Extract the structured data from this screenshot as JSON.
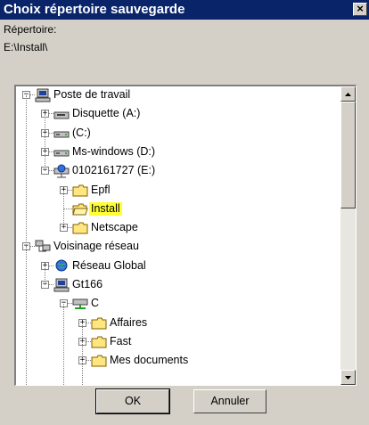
{
  "window": {
    "title": "Choix répertoire sauvegarde",
    "close_label": "×"
  },
  "directory": {
    "label": "Répertoire:",
    "path": "E:\\Install\\"
  },
  "tree": [
    {
      "label": "Poste de travail",
      "icon": "computer-icon",
      "expander": "−"
    },
    {
      "label": "Disquette (A:)",
      "icon": "floppy-drive-icon",
      "expander": "+"
    },
    {
      "label": "(C:)",
      "icon": "hard-drive-icon",
      "expander": "+"
    },
    {
      "label": "Ms-windows (D:)",
      "icon": "hard-drive-icon",
      "expander": "+"
    },
    {
      "label": "0102161727 (E:)",
      "icon": "network-drive-icon",
      "expander": "−"
    },
    {
      "label": "Epfl",
      "icon": "folder-icon",
      "expander": "+"
    },
    {
      "label": "Install",
      "icon": "folder-open-icon",
      "expander": "",
      "selected": true
    },
    {
      "label": "Netscape",
      "icon": "folder-icon",
      "expander": "+"
    },
    {
      "label": "Voisinage réseau",
      "icon": "network-neighborhood-icon",
      "expander": "−"
    },
    {
      "label": "Réseau Global",
      "icon": "globe-icon",
      "expander": "+"
    },
    {
      "label": "Gt166",
      "icon": "computer-icon",
      "expander": "−"
    },
    {
      "label": "C",
      "icon": "shared-drive-icon",
      "expander": "−"
    },
    {
      "label": "Affaires",
      "icon": "folder-icon",
      "expander": "+"
    },
    {
      "label": "Fast",
      "icon": "folder-icon",
      "expander": "+"
    },
    {
      "label": "Mes documents",
      "icon": "folder-icon",
      "expander": "+"
    }
  ],
  "buttons": {
    "ok": "OK",
    "cancel": "Annuler"
  },
  "colors": {
    "titlebar": "#0a246a",
    "selection": "#ffff33",
    "folder": "#ffe680"
  }
}
